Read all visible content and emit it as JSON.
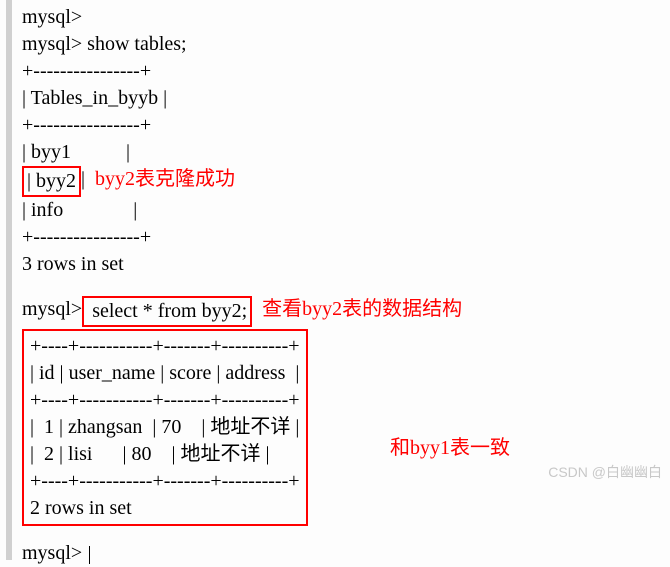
{
  "prompt1": "mysql>",
  "cmd_show": "mysql> show tables;",
  "table_sep": "+----------------+",
  "table_header": "| Tables_in_byyb |",
  "row_byy1": "| byy1           |",
  "row_byy2": "| byy2           ",
  "row_byy2_end": "|",
  "row_info": "| info              |",
  "rows3": "3 rows in set",
  "cmd_select_prefix": "mysql>",
  "cmd_select": " select * from byy2;",
  "select_sep": "+----+-----------+-------+----------+",
  "select_header": "| id | user_name | score | address  |",
  "select_row1": "|  1 | zhangsan  | 70    | 地址不详 |",
  "select_row2": "|  2 | lisi      | 80    | 地址不详 |",
  "rows2": "2 rows in set",
  "prompt_end": "mysql> ",
  "annot_clone": "byy2表克隆成功",
  "annot_view": "查看byy2表的数据结构",
  "annot_same": "和byy1表一致",
  "watermark": "CSDN @白幽幽白"
}
